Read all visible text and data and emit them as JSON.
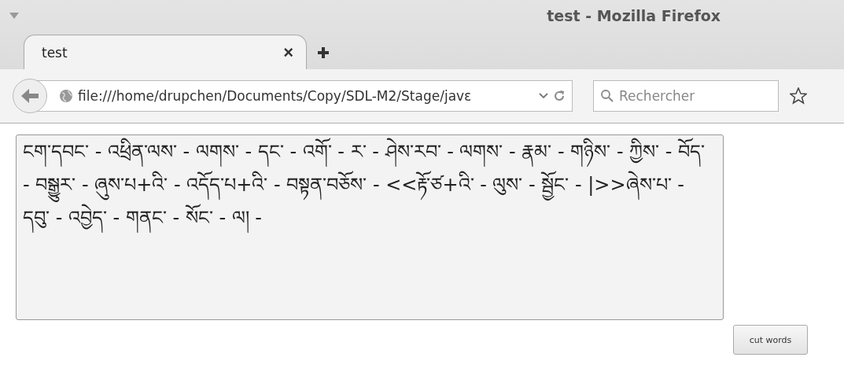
{
  "window": {
    "title": "test - Mozilla Firefox"
  },
  "tabs": [
    {
      "label": "test",
      "selected": true,
      "close": "×"
    }
  ],
  "url_bar": {
    "value": "file:///home/drupchen/Documents/Copy/SDL-M2/Stage/javε"
  },
  "search": {
    "placeholder": "Rechercher"
  },
  "editor": {
    "value": "ངག་དབང་ - འཕྲིན་ལས་ - ལགས་ - དང་ - འགོ་ - ར་ - ཤེས་རབ་ - ལགས་ - རྣམ་ - གཉིས་ - ཀྱིས་ - བོད་ - བསྒྱུར་ - ཞུས་པ+འི་ - འདོད་པ+འི་ - བསྟན་བཅོས་ - <<རྟོ་ཙ+འི་ - ལུས་ - སྦྱོང་ - |>>ཞེས་པ་ - དབུ་ - འབྱེད་ - གནང་ - སོང་ - ལ། -"
  },
  "button": {
    "label": "cut words"
  }
}
